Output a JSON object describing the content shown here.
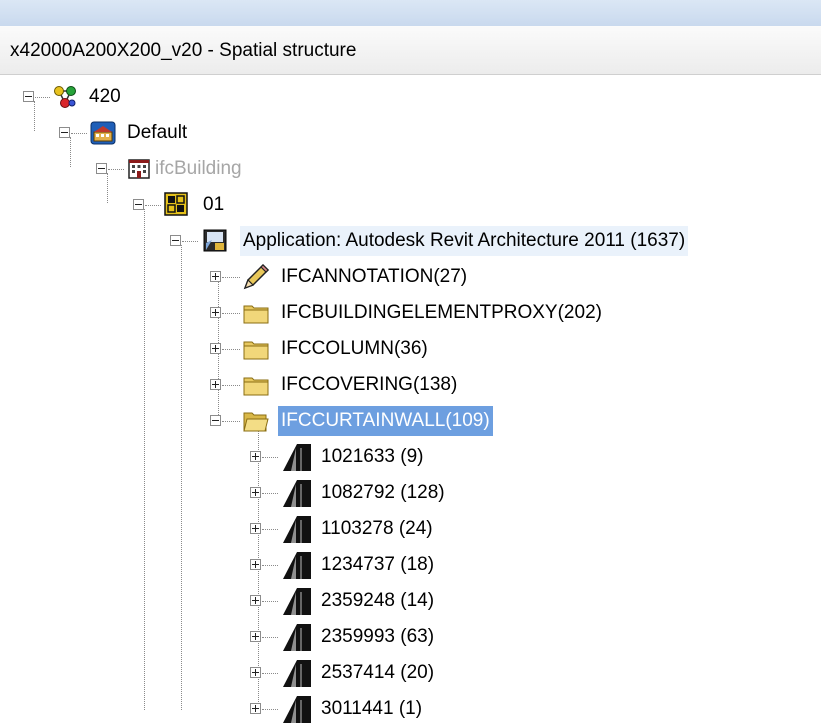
{
  "window": {
    "title": "x42000A200X200_v20 - Spatial structure"
  },
  "tree": {
    "project": {
      "label": "420"
    },
    "site": {
      "label": "Default"
    },
    "building": {
      "label": "ifcBuilding"
    },
    "storey": {
      "label": "01"
    },
    "application": {
      "label": "Application: Autodesk Revit Architecture 2011 (1637)"
    },
    "groups": [
      {
        "label": "IFCANNOTATION(27)",
        "icon": "pencil-icon"
      },
      {
        "label": "IFCBUILDINGELEMENTPROXY(202)",
        "icon": "folder-icon"
      },
      {
        "label": "IFCCOLUMN(36)",
        "icon": "folder-icon"
      },
      {
        "label": "IFCCOVERING(138)",
        "icon": "folder-icon"
      },
      {
        "label": "IFCCURTAINWALL(109)",
        "icon": "open-folder-icon",
        "selected": true
      }
    ],
    "curtainwalls": [
      {
        "label": "1021633 (9)"
      },
      {
        "label": "1082792 (128)"
      },
      {
        "label": "1103278 (24)"
      },
      {
        "label": "1234737 (18)"
      },
      {
        "label": "2359248 (14)"
      },
      {
        "label": "2359993 (63)"
      },
      {
        "label": "2537414 (20)"
      },
      {
        "label": "3011441 (1)"
      }
    ]
  },
  "colors": {
    "selection": "#6d9fe0",
    "highlight": "#eaf2fb",
    "disabled_text": "#a6a6a6"
  }
}
